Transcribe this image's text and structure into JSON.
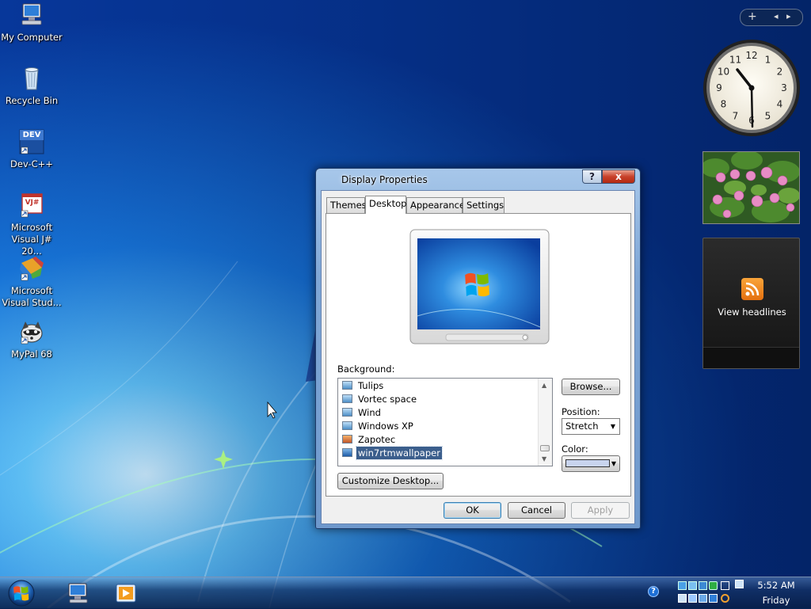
{
  "desktop": {
    "icons": [
      {
        "name": "my-computer",
        "lines": [
          "My Computer"
        ]
      },
      {
        "name": "recycle-bin",
        "lines": [
          "Recycle Bin"
        ]
      },
      {
        "name": "dev-cpp",
        "badge": "DEV",
        "lines": [
          "Dev-C++"
        ]
      },
      {
        "name": "visual-jsharp",
        "badge": "VJ#",
        "lines": [
          "Microsoft",
          "Visual J# 20..."
        ]
      },
      {
        "name": "visual-studio",
        "lines": [
          "Microsoft",
          "Visual Stud..."
        ]
      },
      {
        "name": "mypal",
        "lines": [
          "MyPal 68"
        ]
      }
    ]
  },
  "gadgets": {
    "toolbar": {
      "add": "+",
      "prev": "◂",
      "next": "▸"
    },
    "clock": {
      "numerals": [
        "12",
        "1",
        "2",
        "3",
        "4",
        "5",
        "6",
        "7",
        "8",
        "9",
        "10",
        "11"
      ]
    },
    "feed": {
      "text": "View headlines"
    }
  },
  "dialog": {
    "title": "Display Properties",
    "help_label": "?",
    "close_label": "x",
    "tabs": [
      "Themes",
      "Desktop",
      "Appearance",
      "Settings"
    ],
    "active_tab": "Desktop",
    "background_label": "Background:",
    "background_items": [
      "Tulips",
      "Vortec space",
      "Wind",
      "Windows XP",
      "Zapotec",
      "win7rtmwallpaper"
    ],
    "selected_background": "win7rtmwallpaper",
    "browse_label": "Browse...",
    "position_label": "Position:",
    "position_value": "Stretch",
    "color_label": "Color:",
    "color_value": "#c8d4ee",
    "customize_label": "Customize Desktop...",
    "ok_label": "OK",
    "cancel_label": "Cancel",
    "apply_label": "Apply"
  },
  "taskbar": {
    "time": "5:52 AM",
    "day": "Friday",
    "help_icon": "?"
  },
  "colors": {
    "desktop_blue": "#0a4fb8",
    "dialog_frame": "#7fa7d6",
    "close_red": "#c8412b",
    "selection": "#3b5e8c"
  }
}
